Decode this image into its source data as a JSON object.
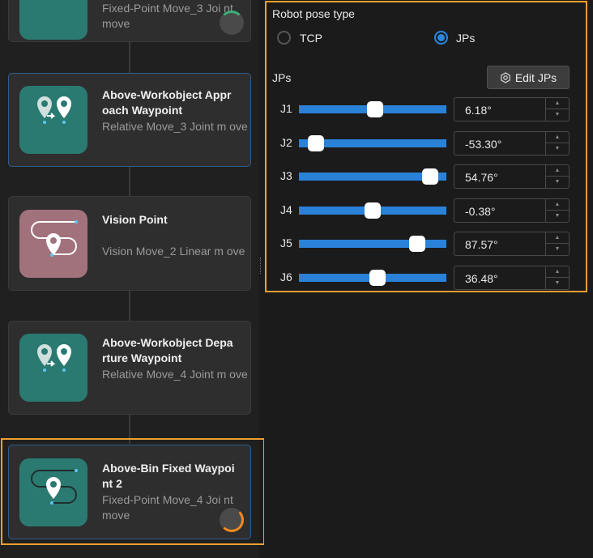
{
  "workflow": {
    "cards": [
      {
        "title": "",
        "subtitle": "Fixed-Point Move_3   Joi nt move",
        "icon": "fixed-point-move-icon",
        "status": "running-green"
      },
      {
        "title": "Above-Workobject Appr oach Waypoint",
        "subtitle": "Relative Move_3   Joint m ove",
        "icon": "relative-move-icon"
      },
      {
        "title": "Vision Point",
        "subtitle": "Vision Move_2   Linear m ove",
        "icon": "vision-move-icon"
      },
      {
        "title": "Above-Workobject Depa rture Waypoint",
        "subtitle": "Relative Move_4   Joint m ove",
        "icon": "relative-move-icon"
      },
      {
        "title": "Above-Bin Fixed Waypoi nt 2",
        "subtitle": "Fixed-Point Move_4   Joi nt move",
        "icon": "fixed-point-move-icon",
        "status": "running-orange"
      }
    ]
  },
  "pose": {
    "title": "Robot pose type",
    "options": [
      "TCP",
      "JPs"
    ],
    "selected": "JPs",
    "jps_label": "JPs",
    "edit_label": "Edit JPs",
    "joints": [
      {
        "name": "J1",
        "value": "6.18°",
        "fraction": 0.52
      },
      {
        "name": "J2",
        "value": "-53.30°",
        "fraction": 0.07
      },
      {
        "name": "J3",
        "value": "54.76°",
        "fraction": 0.94
      },
      {
        "name": "J4",
        "value": "-0.38°",
        "fraction": 0.5
      },
      {
        "name": "J5",
        "value": "87.57°",
        "fraction": 0.84
      },
      {
        "name": "J6",
        "value": "36.48°",
        "fraction": 0.54
      }
    ]
  },
  "colors": {
    "accent": "#2a82d8",
    "highlight": "#f0a030",
    "teal": "#2a7a72",
    "pink": "#a2727c"
  }
}
